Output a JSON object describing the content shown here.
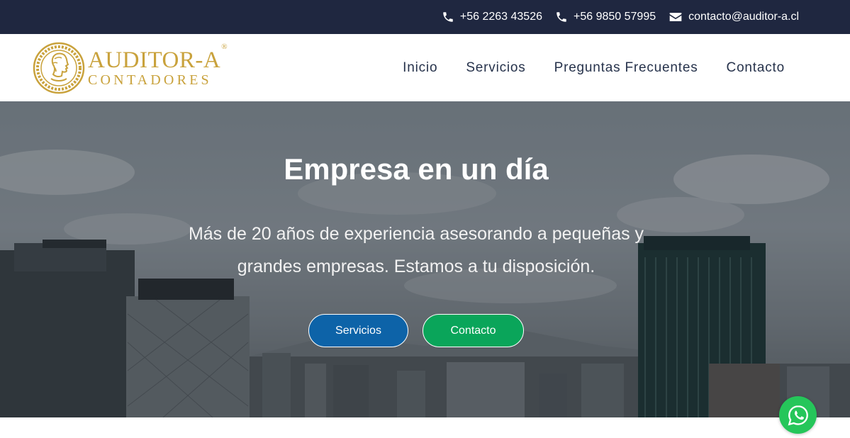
{
  "topbar": {
    "phone1": "+56 2263 43526",
    "phone2": "+56 9850 57995",
    "email": "contacto@auditor-a.cl"
  },
  "logo": {
    "name": "AUDITOR-A",
    "registered": "®",
    "subtitle": "CONTADORES"
  },
  "nav": {
    "items": [
      "Inicio",
      "Servicios",
      "Preguntas Frecuentes",
      "Contacto"
    ]
  },
  "hero": {
    "title": "Empresa en un día",
    "description": "Más de 20 años de experiencia asesorando a pequeñas y grandes empresas. Estamos a tu disposición.",
    "button_services": "Servicios",
    "button_contact": "Contacto"
  },
  "colors": {
    "topbar_bg": "#1f2740",
    "logo_gold": "#c9a23c",
    "nav_text": "#26324b",
    "button_services": "#0d63a8",
    "button_contact": "#0aa55a",
    "whatsapp": "#25c65a"
  },
  "icons": {
    "phone": "phone-icon",
    "email": "envelope-icon",
    "whatsapp": "whatsapp-icon"
  }
}
